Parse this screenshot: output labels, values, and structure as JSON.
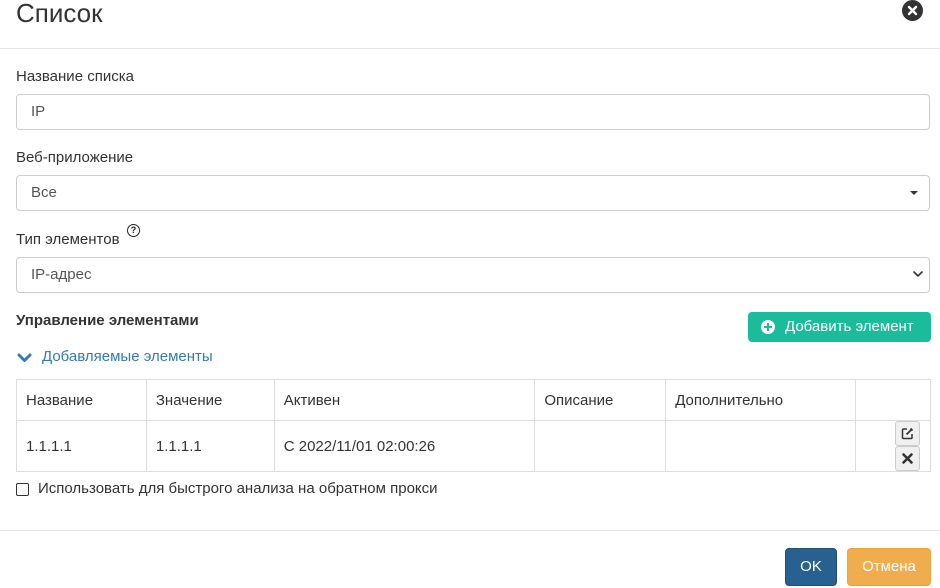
{
  "dialog": {
    "title": "Список"
  },
  "form": {
    "list_name": {
      "label": "Название списка",
      "value": "IP"
    },
    "web_app": {
      "label": "Веб-приложение",
      "value": "Все"
    },
    "element_type": {
      "label": "Тип элементов",
      "help": "?",
      "value": "IP-адрес"
    }
  },
  "elements": {
    "section_title": "Управление элементами",
    "add_button": "Добавить элемент",
    "collapse_label": "Добавляемые элементы",
    "columns": [
      "Название",
      "Значение",
      "Активен",
      "Описание",
      "Дополнительно",
      ""
    ],
    "rows": [
      {
        "name": "1.1.1.1",
        "value": "1.1.1.1",
        "active": "С 2022/11/01 02:00:26",
        "description": "",
        "extra": ""
      }
    ]
  },
  "options": {
    "reverse_proxy_checkbox": "Использовать для быстрого анализа на обратном прокси",
    "reverse_proxy_checked": false
  },
  "footer": {
    "ok": "OK",
    "cancel": "Отмена"
  },
  "colors": {
    "primary": "#286090",
    "success": "#1abc9c",
    "warning": "#f0ad4e",
    "link": "#337ab7"
  }
}
